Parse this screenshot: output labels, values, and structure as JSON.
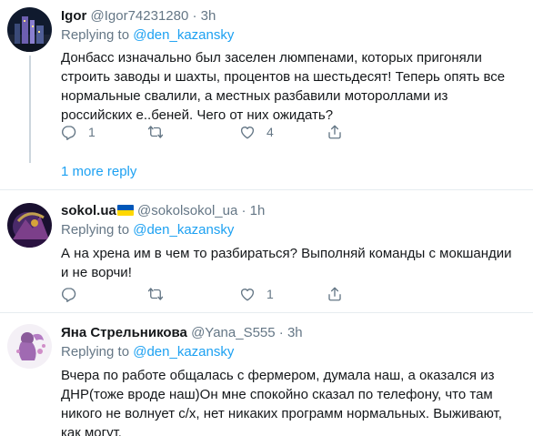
{
  "tweets": [
    {
      "display_name": "Igor",
      "handle": "@Igor74231280",
      "dot": "·",
      "time": "3h",
      "replying_prefix": "Replying to",
      "replying_to": "@den_kazansky",
      "lines": [
        "Донбасс изначально был заселен люмпенами, которых пригоняли",
        "строить заводы и шахты, процентов на шестьдесят! Теперь опять все",
        "нормальные свалили, а местных разбавили мотороллами из",
        "российских е..беней. Чего от них ожидать?"
      ],
      "reply_count": "1",
      "retweet_count": "",
      "like_count": "4",
      "more_replies": "1 more reply"
    },
    {
      "display_name": "sokol.ua",
      "handle": "@sokolsokol_ua",
      "dot": "·",
      "time": "1h",
      "replying_prefix": "Replying to",
      "replying_to": "@den_kazansky",
      "lines": [
        "А на хрена им в чем то разбираться? Выполняй команды с мокшандии",
        "и не ворчи!"
      ],
      "reply_count": "",
      "retweet_count": "",
      "like_count": "1"
    },
    {
      "display_name": "Яна Стрельникова",
      "handle": "@Yana_S555",
      "dot": "·",
      "time": "3h",
      "replying_prefix": "Replying to",
      "replying_to": "@den_kazansky",
      "lines": [
        "Вчера по работе общалась с фермером, думала наш, а оказался из",
        "ДНР(тоже вроде наш)Он мне спокойно сказал по телефону, что там",
        "никого не волнует с/х, нет никаких программ нормальных. Выживают,",
        "как могут."
      ]
    }
  ],
  "icons": [
    "reply-icon",
    "retweet-icon",
    "like-icon",
    "share-icon",
    "ukraine-flag-icon"
  ],
  "colors": {
    "link": "#1da1f2",
    "muted": "#657786",
    "text": "#14171a",
    "divider": "#e6ecf0"
  }
}
